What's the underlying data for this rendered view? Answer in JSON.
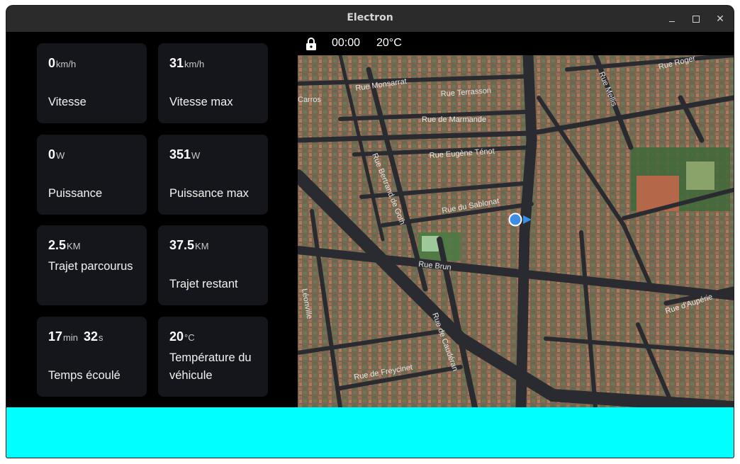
{
  "window": {
    "title": "Electron"
  },
  "stats": {
    "speed": {
      "value": "0",
      "unit": "km/h",
      "label": "Vitesse"
    },
    "speed_max": {
      "value": "31",
      "unit": "km/h",
      "label": "Vitesse max"
    },
    "power": {
      "value": "0",
      "unit": "W",
      "label": "Puissance"
    },
    "power_max": {
      "value": "351",
      "unit": "W",
      "label": "Puissance max"
    },
    "trip_done": {
      "value": "2.5",
      "unit": "KM",
      "label": "Trajet parcourus"
    },
    "trip_left": {
      "value": "37.5",
      "unit": "KM",
      "label": "Trajet restant"
    },
    "elapsed": {
      "minutes": "17",
      "min_unit": "min",
      "seconds": "32",
      "sec_unit": "s",
      "label": "Temps écoulé"
    },
    "vehicle_temp": {
      "value": "20",
      "unit": "°C",
      "label": "Température du véhicule"
    }
  },
  "map": {
    "clock": "00:00",
    "temperature": "20°C",
    "streets": [
      "Rue Monsarrat",
      "Rue Terrasson",
      "Carros",
      "Rue de Marmande",
      "Rue Eugène Ténot",
      "Rue Bertrand de Goth",
      "Rue du Sablonat",
      "Rue Brun",
      "Rue de Caudéran",
      "Rue de Freycinet",
      "Rue d'Aupérie",
      "Rue Mellis",
      "Rue Roger",
      "Léonville"
    ]
  },
  "colors": {
    "accent_bar": "#00ffff",
    "card_bg": "#15161c",
    "position_dot": "#3a8ee6"
  }
}
